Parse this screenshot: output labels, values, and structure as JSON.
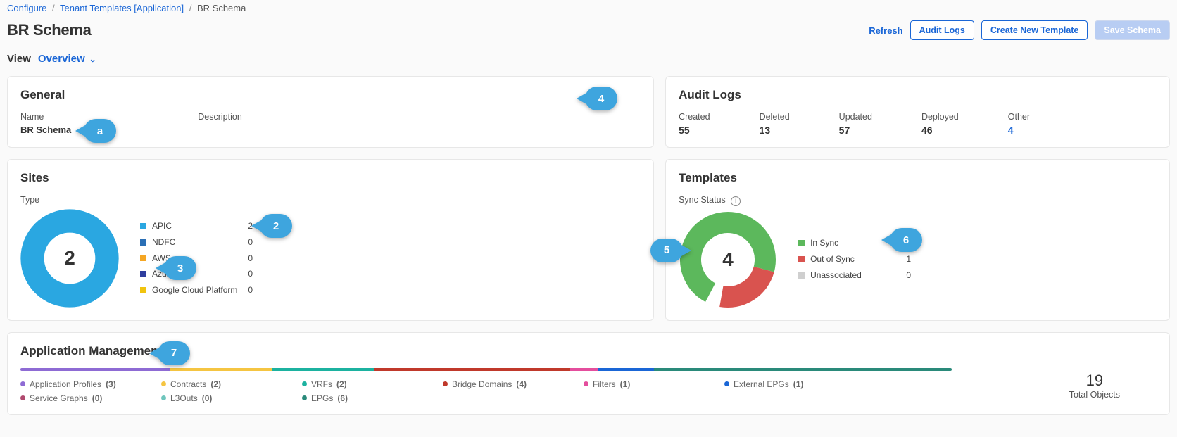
{
  "breadcrumb": {
    "a": "Configure",
    "b": "Tenant Templates [Application]",
    "c": "BR Schema"
  },
  "pagetitle": "BR Schema",
  "actions": {
    "refresh": "Refresh",
    "audit": "Audit Logs",
    "create": "Create New Template",
    "save": "Save Schema"
  },
  "view": {
    "label": "View",
    "value": "Overview"
  },
  "general": {
    "title": "General",
    "name_label": "Name",
    "name_value": "BR Schema",
    "desc_label": "Description"
  },
  "auditlogs": {
    "title": "Audit Logs",
    "items": [
      {
        "label": "Created",
        "value": "55"
      },
      {
        "label": "Deleted",
        "value": "13"
      },
      {
        "label": "Updated",
        "value": "57"
      },
      {
        "label": "Deployed",
        "value": "46"
      },
      {
        "label": "Other",
        "value": "4",
        "link": true
      }
    ]
  },
  "sites": {
    "title": "Sites",
    "type_label": "Type",
    "total": "2",
    "items": [
      {
        "label": "APIC",
        "value": "2",
        "color": "#2aa7e1"
      },
      {
        "label": "NDFC",
        "value": "0",
        "color": "#2b6fb5"
      },
      {
        "label": "AWS",
        "value": "0",
        "color": "#f5a623"
      },
      {
        "label": "Azure",
        "value": "0",
        "color": "#2f3e9e"
      },
      {
        "label": "Google Cloud Platform",
        "value": "0",
        "color": "#f1c40f"
      }
    ]
  },
  "templates": {
    "title": "Templates",
    "sync_label": "Sync Status",
    "total": "4",
    "items": [
      {
        "label": "In Sync",
        "value": "3",
        "color": "#5cb85c"
      },
      {
        "label": "Out of Sync",
        "value": "1",
        "color": "#d9534f"
      },
      {
        "label": "Unassociated",
        "value": "0",
        "color": "#cfcfcf"
      }
    ]
  },
  "appmgmt": {
    "title": "Application Management",
    "total": "19",
    "total_label": "Total Objects",
    "items": [
      {
        "label": "Application Profiles",
        "count": "(3)",
        "color": "#8e6bd4",
        "w": 16
      },
      {
        "label": "Contracts",
        "count": "(2)",
        "color": "#f5c542",
        "w": 11
      },
      {
        "label": "VRFs",
        "count": "(2)",
        "color": "#1cb2a0",
        "w": 11
      },
      {
        "label": "Bridge Domains",
        "count": "(4)",
        "color": "#c0392b",
        "w": 21
      },
      {
        "label": "Filters",
        "count": "(1)",
        "color": "#e44e9d",
        "w": 3
      },
      {
        "label": "External EPGs",
        "count": "(1)",
        "color": "#1a66d6",
        "w": 6
      },
      {
        "label": "Service Graphs",
        "count": "(0)",
        "color": "#b04a6f",
        "w": 0
      },
      {
        "label": "L3Outs",
        "count": "(0)",
        "color": "#6fc6bd",
        "w": 0
      },
      {
        "label": "EPGs",
        "count": "(6)",
        "color": "#2a8a7a",
        "w": 32
      }
    ]
  },
  "callouts": {
    "a": "a",
    "c2": "2",
    "c3": "3",
    "c4": "4",
    "c5": "5",
    "c6": "6",
    "c7": "7"
  },
  "chart_data": [
    {
      "type": "pie",
      "title": "Sites — Type",
      "categories": [
        "APIC",
        "NDFC",
        "AWS",
        "Azure",
        "Google Cloud Platform"
      ],
      "values": [
        2,
        0,
        0,
        0,
        0
      ],
      "colors": [
        "#2aa7e1",
        "#2b6fb5",
        "#f5a623",
        "#2f3e9e",
        "#f1c40f"
      ],
      "total": 2
    },
    {
      "type": "pie",
      "title": "Templates — Sync Status",
      "categories": [
        "In Sync",
        "Out of Sync",
        "Unassociated"
      ],
      "values": [
        3,
        1,
        0
      ],
      "colors": [
        "#5cb85c",
        "#d9534f",
        "#cfcfcf"
      ],
      "total": 4
    },
    {
      "type": "bar",
      "title": "Application Management",
      "categories": [
        "Application Profiles",
        "Contracts",
        "VRFs",
        "Bridge Domains",
        "Filters",
        "External EPGs",
        "Service Graphs",
        "L3Outs",
        "EPGs"
      ],
      "values": [
        3,
        2,
        2,
        4,
        1,
        1,
        0,
        0,
        6
      ],
      "colors": [
        "#8e6bd4",
        "#f5c542",
        "#1cb2a0",
        "#c0392b",
        "#e44e9d",
        "#1a66d6",
        "#b04a6f",
        "#6fc6bd",
        "#2a8a7a"
      ],
      "total": 19
    }
  ]
}
